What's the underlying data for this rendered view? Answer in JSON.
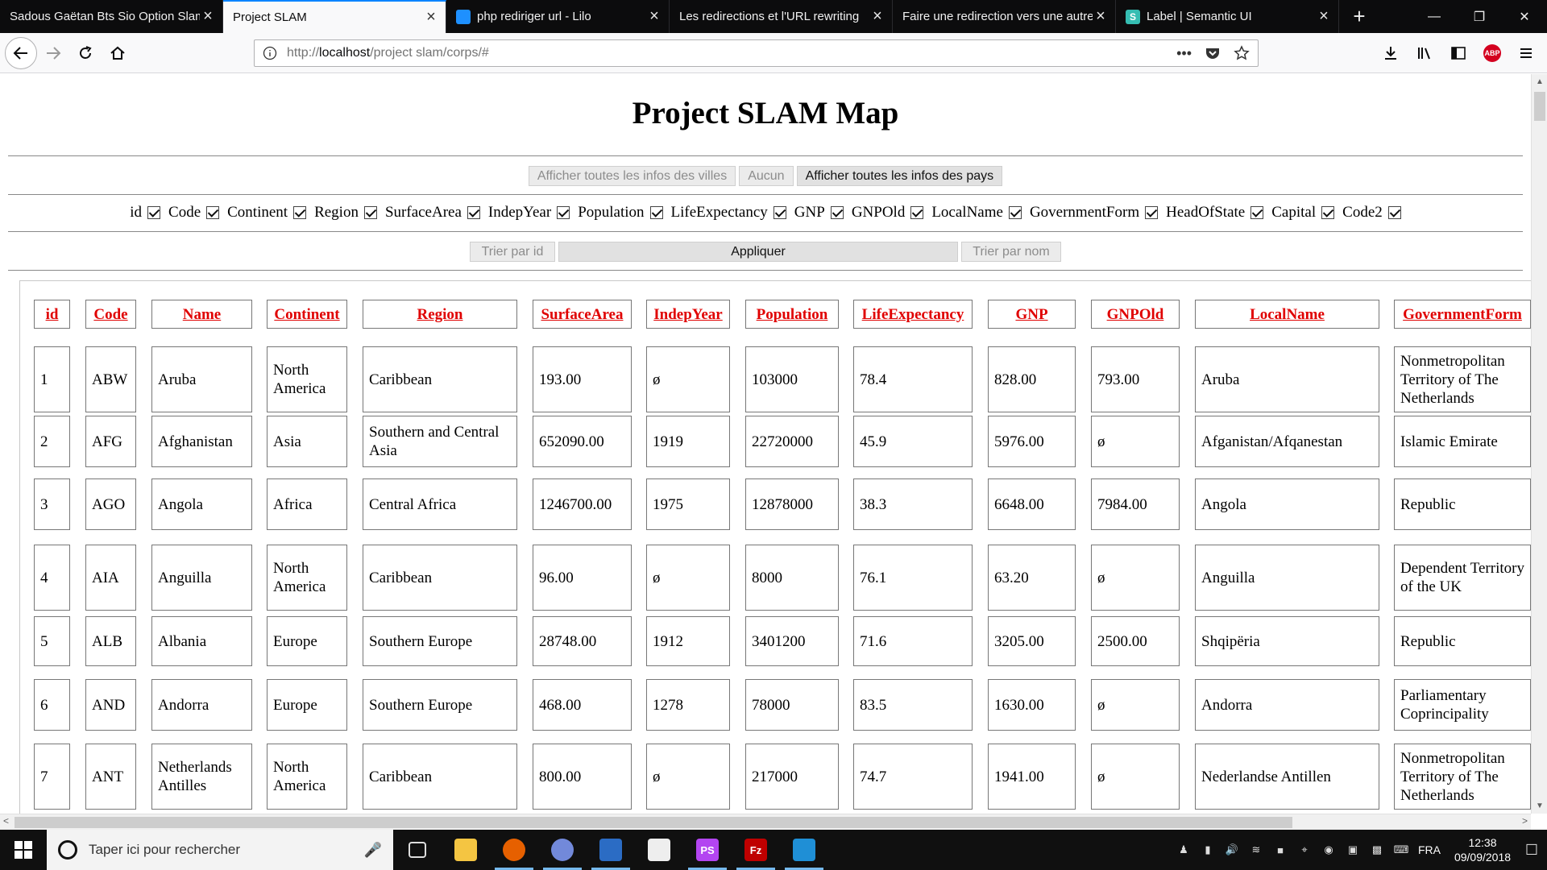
{
  "browser": {
    "tabs": [
      {
        "title": "Sadous Gaëtan Bts Sio Option Slam",
        "active": false,
        "favicon": "none"
      },
      {
        "title": "Project SLAM",
        "active": true,
        "favicon": "none"
      },
      {
        "title": "php rediriger url - Lilo",
        "active": false,
        "favicon": "lilo-icon"
      },
      {
        "title": "Les redirections et l'URL rewriting",
        "active": false,
        "favicon": "none"
      },
      {
        "title": "Faire une redirection vers une autre",
        "active": false,
        "favicon": "none"
      },
      {
        "title": "Label | Semantic UI",
        "active": false,
        "favicon": "semantic-icon"
      }
    ],
    "url_prefix": "http://",
    "url_host": "localhost",
    "url_path": "/project slam/corps/#"
  },
  "page": {
    "title": "Project SLAM Map",
    "buttons_top": [
      {
        "label": "Afficher toutes les infos des villes",
        "active": false
      },
      {
        "label": "Aucun",
        "active": false
      },
      {
        "label": "Afficher toutes les infos des pays",
        "active": true
      }
    ],
    "checkboxes": [
      {
        "label": "id",
        "checked": true
      },
      {
        "label": "Code",
        "checked": true
      },
      {
        "label": "Continent",
        "checked": true
      },
      {
        "label": "Region",
        "checked": true
      },
      {
        "label": "SurfaceArea",
        "checked": true
      },
      {
        "label": "IndepYear",
        "checked": true
      },
      {
        "label": "Population",
        "checked": true
      },
      {
        "label": "LifeExpectancy",
        "checked": true
      },
      {
        "label": "GNP",
        "checked": true
      },
      {
        "label": "GNPOld",
        "checked": true
      },
      {
        "label": "LocalName",
        "checked": true
      },
      {
        "label": "GovernmentForm",
        "checked": true
      },
      {
        "label": "HeadOfState",
        "checked": true
      },
      {
        "label": "Capital",
        "checked": true
      },
      {
        "label": "Code2",
        "checked": true
      }
    ],
    "sort_buttons": {
      "sort_id": "Trier par id",
      "apply": "Appliquer",
      "sort_name": "Trier par nom"
    },
    "table": {
      "headers": [
        "id",
        "Code",
        "Name",
        "Continent",
        "Region",
        "SurfaceArea",
        "IndepYear",
        "Population",
        "LifeExpectancy",
        "GNP",
        "GNPOld",
        "LocalName",
        "GovernmentForm"
      ],
      "rows": [
        [
          "1",
          "ABW",
          "Aruba",
          "North America",
          "Caribbean",
          "193.00",
          "ø",
          "103000",
          "78.4",
          "828.00",
          "793.00",
          "Aruba",
          "Nonmetropolitan Territory of The Netherlands"
        ],
        [
          "2",
          "AFG",
          "Afghanistan",
          "Asia",
          "Southern and Central Asia",
          "652090.00",
          "1919",
          "22720000",
          "45.9",
          "5976.00",
          "ø",
          "Afganistan/Afqanestan",
          "Islamic Emirate"
        ],
        [
          "3",
          "AGO",
          "Angola",
          "Africa",
          "Central Africa",
          "1246700.00",
          "1975",
          "12878000",
          "38.3",
          "6648.00",
          "7984.00",
          "Angola",
          "Republic"
        ],
        [
          "4",
          "AIA",
          "Anguilla",
          "North America",
          "Caribbean",
          "96.00",
          "ø",
          "8000",
          "76.1",
          "63.20",
          "ø",
          "Anguilla",
          "Dependent Territory of the UK"
        ],
        [
          "5",
          "ALB",
          "Albania",
          "Europe",
          "Southern Europe",
          "28748.00",
          "1912",
          "3401200",
          "71.6",
          "3205.00",
          "2500.00",
          "Shqipëria",
          "Republic"
        ],
        [
          "6",
          "AND",
          "Andorra",
          "Europe",
          "Southern Europe",
          "468.00",
          "1278",
          "78000",
          "83.5",
          "1630.00",
          "ø",
          "Andorra",
          "Parliamentary Coprincipality"
        ],
        [
          "7",
          "ANT",
          "Netherlands Antilles",
          "North America",
          "Caribbean",
          "800.00",
          "ø",
          "217000",
          "74.7",
          "1941.00",
          "ø",
          "Nederlandse Antillen",
          "Nonmetropolitan Territory of The Netherlands"
        ]
      ]
    }
  },
  "taskbar": {
    "search_placeholder": "Taper ici pour rechercher",
    "apps": [
      {
        "name": "task-view-icon",
        "label": ""
      },
      {
        "name": "file-explorer-icon",
        "label": ""
      },
      {
        "name": "firefox-icon",
        "label": ""
      },
      {
        "name": "discord-icon",
        "label": ""
      },
      {
        "name": "window-app-icon",
        "label": ""
      },
      {
        "name": "penguin-app-icon",
        "label": ""
      },
      {
        "name": "phpstorm-icon",
        "label": "PS"
      },
      {
        "name": "filezilla-icon",
        "label": "Fz"
      },
      {
        "name": "visual-studio-icon",
        "label": ""
      }
    ],
    "language": "FRA",
    "time": "12:38",
    "date": "09/09/2018"
  },
  "colors": {
    "header_link": "#e00000",
    "tab_accent": "#0a84ff",
    "tab_strip": "#0c0c0d"
  }
}
